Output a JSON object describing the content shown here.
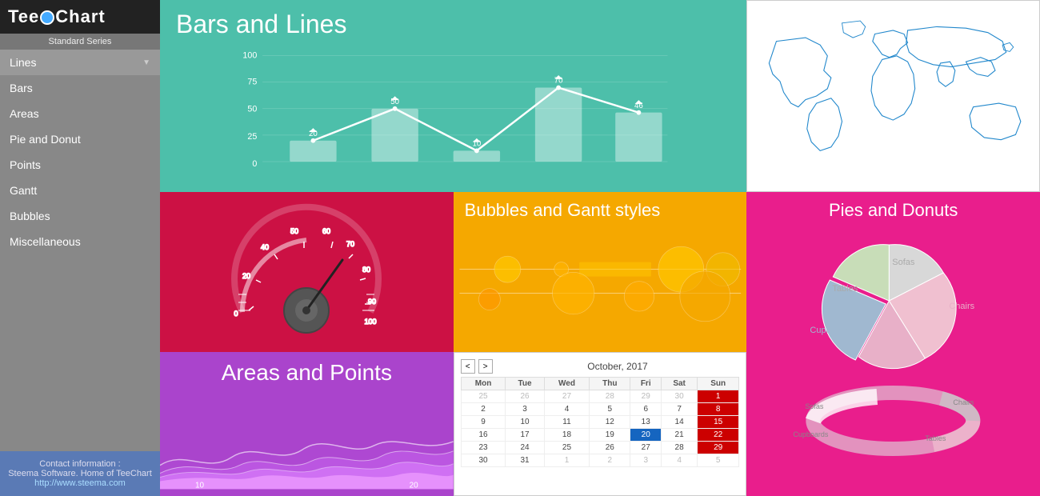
{
  "sidebar": {
    "logo": "TeeChart",
    "standard_series": "Standard Series",
    "items": [
      {
        "label": "Lines",
        "active": true,
        "has_arrow": true
      },
      {
        "label": "Bars",
        "active": false,
        "has_arrow": false
      },
      {
        "label": "Areas",
        "active": false,
        "has_arrow": false
      },
      {
        "label": "Pie and Donut",
        "active": false,
        "has_arrow": false
      },
      {
        "label": "Points",
        "active": false,
        "has_arrow": false
      },
      {
        "label": "Gantt",
        "active": false,
        "has_arrow": false
      },
      {
        "label": "Bubbles",
        "active": false,
        "has_arrow": false
      },
      {
        "label": "Miscellaneous",
        "active": false,
        "has_arrow": false
      }
    ],
    "contact_label": "Contact information :",
    "contact_company": "Steema Software. Home of TeeChart",
    "contact_url": "http://www.steema.com"
  },
  "panels": {
    "bars_lines": {
      "title": "Bars and Lines",
      "y_labels": [
        "100",
        "75",
        "50",
        "25",
        "0"
      ],
      "bar_values": [
        {
          "x": 1,
          "v": 20
        },
        {
          "x": 2,
          "v": 50
        },
        {
          "x": 3,
          "v": 10
        },
        {
          "x": 4,
          "v": 70
        },
        {
          "x": 5,
          "v": 46
        }
      ]
    },
    "bubbles": {
      "title": "Bubbles and Gantt styles"
    },
    "pies": {
      "title": "Pies and Donuts",
      "segments": [
        {
          "label": "Sofas",
          "color": "#e0e0e0",
          "angle": 80
        },
        {
          "label": "Chairs",
          "color": "#f0c0d0",
          "angle": 110
        },
        {
          "label": "Cupboards",
          "color": "#c0d0e0",
          "angle": 80
        },
        {
          "label": "Tables",
          "color": "#d0e0c0",
          "angle": 90
        }
      ]
    },
    "areas": {
      "title": "Areas and Points",
      "x_labels": [
        "10",
        "20"
      ]
    },
    "calendar": {
      "month": "October, 2017",
      "days_header": [
        "Mon",
        "Tue",
        "Wed",
        "Thu",
        "Fri",
        "Sat",
        "Sun"
      ],
      "weeks": [
        [
          {
            "d": "25",
            "c": "other"
          },
          {
            "d": "26",
            "c": "other"
          },
          {
            "d": "27",
            "c": "other"
          },
          {
            "d": "28",
            "c": "other"
          },
          {
            "d": "29",
            "c": "other"
          },
          {
            "d": "30",
            "c": "other"
          },
          {
            "d": "1",
            "c": "red"
          }
        ],
        [
          {
            "d": "2",
            "c": ""
          },
          {
            "d": "3",
            "c": ""
          },
          {
            "d": "4",
            "c": ""
          },
          {
            "d": "5",
            "c": ""
          },
          {
            "d": "6",
            "c": ""
          },
          {
            "d": "7",
            "c": ""
          },
          {
            "d": "8",
            "c": "red"
          }
        ],
        [
          {
            "d": "9",
            "c": ""
          },
          {
            "d": "10",
            "c": ""
          },
          {
            "d": "11",
            "c": ""
          },
          {
            "d": "12",
            "c": ""
          },
          {
            "d": "13",
            "c": ""
          },
          {
            "d": "14",
            "c": ""
          },
          {
            "d": "15",
            "c": "red"
          }
        ],
        [
          {
            "d": "16",
            "c": ""
          },
          {
            "d": "17",
            "c": ""
          },
          {
            "d": "18",
            "c": ""
          },
          {
            "d": "19",
            "c": ""
          },
          {
            "d": "20",
            "c": "today"
          },
          {
            "d": "21",
            "c": ""
          },
          {
            "d": "22",
            "c": "red"
          }
        ],
        [
          {
            "d": "23",
            "c": ""
          },
          {
            "d": "24",
            "c": ""
          },
          {
            "d": "25",
            "c": ""
          },
          {
            "d": "26",
            "c": ""
          },
          {
            "d": "27",
            "c": ""
          },
          {
            "d": "28",
            "c": ""
          },
          {
            "d": "29",
            "c": "red"
          }
        ],
        [
          {
            "d": "30",
            "c": ""
          },
          {
            "d": "31",
            "c": ""
          },
          {
            "d": "1",
            "c": "other"
          },
          {
            "d": "2",
            "c": "other"
          },
          {
            "d": "3",
            "c": "other"
          },
          {
            "d": "4",
            "c": "other"
          },
          {
            "d": "5",
            "c": "other"
          }
        ]
      ]
    }
  }
}
